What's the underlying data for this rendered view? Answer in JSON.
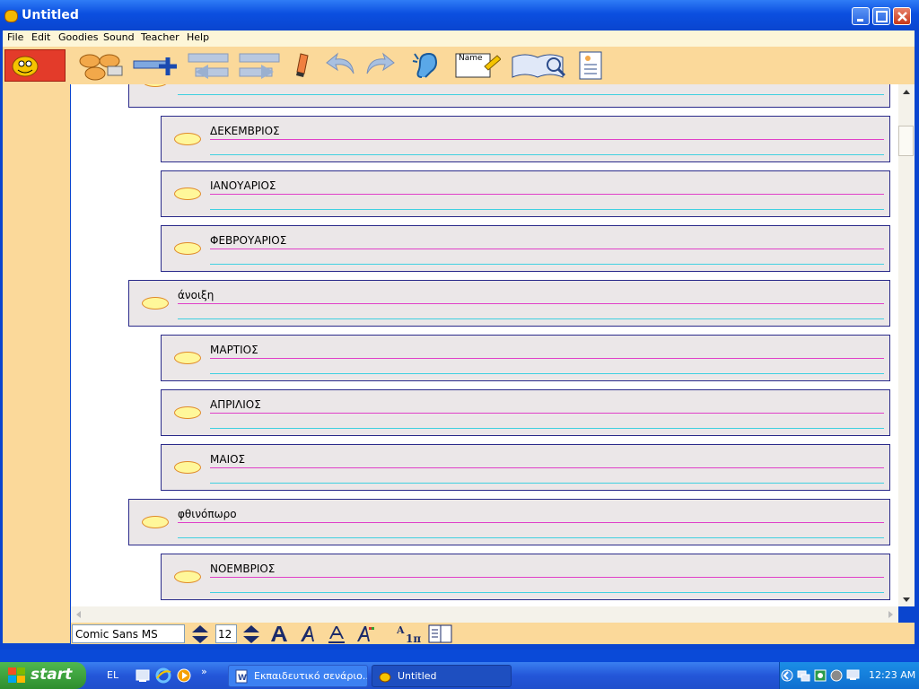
{
  "window": {
    "title": "Untitled"
  },
  "menu": [
    "File",
    "Edit",
    "Goodies",
    "Sound",
    "Teacher",
    "Help"
  ],
  "toolbar": {
    "name_icon_label": "Name"
  },
  "outline": {
    "rows": [
      {
        "label": ""
      },
      {
        "label": "ΔΕΚΕΜΒΡΙΟΣ"
      },
      {
        "label": "ΙΑΝΟΥΑΡΙΟΣ"
      },
      {
        "label": "ΦΕΒΡΟΥΑΡΙΟΣ"
      },
      {
        "label": "άνοιξη"
      },
      {
        "label": "ΜΑΡΤΙΟΣ"
      },
      {
        "label": "ΑΠΡΙΛΙΟΣ"
      },
      {
        "label": "ΜΑΙΟΣ"
      },
      {
        "label": "φθινόπωρο"
      },
      {
        "label": "ΝΟΕΜΒΡΙΟΣ"
      }
    ]
  },
  "formatbar": {
    "font": "Comic Sans MS",
    "size": "12"
  },
  "taskbar": {
    "start": "start",
    "language": "EL",
    "tasks": [
      "Εκπαιδευτικό σενάριο...",
      "Untitled"
    ],
    "clock": "12:23 AM"
  },
  "colors": {
    "accent": "#0a45cf",
    "toolbar": "#fbd99a",
    "row_border": "#2a2a8a",
    "pink_line": "#e040c8",
    "cyan_line": "#40d0e0"
  }
}
